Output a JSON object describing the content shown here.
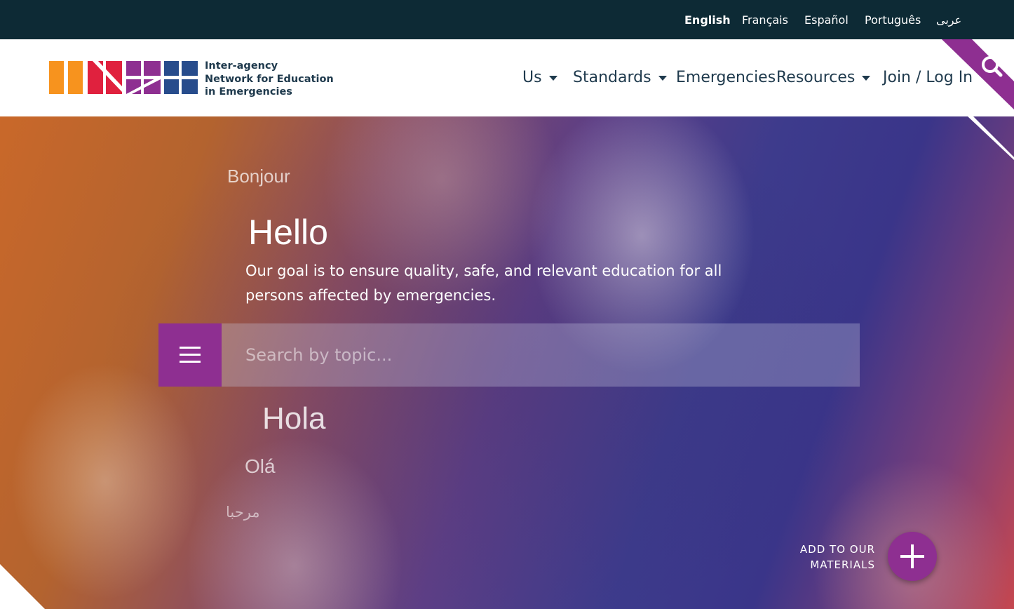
{
  "languages": {
    "english": "English",
    "francais": "Français",
    "espanol": "Español",
    "portugues": "Português",
    "arabic": "عربى"
  },
  "logo": {
    "line1": "Inter-agency",
    "line2": "Network for Education",
    "line3": "in Emergencies"
  },
  "nav": {
    "us": "Us",
    "standards": "Standards",
    "emergencies": "Emergencies",
    "resources": "Resources",
    "join": "Join / Log In"
  },
  "hero": {
    "bonjour": "Bonjour",
    "hello": "Hello",
    "description": "Our goal is to ensure quality, safe, and relevant education for all persons affected by emergencies.",
    "search_placeholder": "Search by topic...",
    "hola": "Hola",
    "ola": "Olá",
    "marhaba": "مرحبا"
  },
  "add_materials": {
    "line1": "ADD TO OUR",
    "line2": "MATERIALS"
  },
  "colors": {
    "top_bar": "#0d2a35",
    "brand_purple": "#8e2f91",
    "text_navy": "#1f3a4d",
    "logo_orange": "#f7931e",
    "logo_red": "#e0213e",
    "logo_purple": "#8e2f91",
    "logo_blue": "#274c8c"
  },
  "icons": {
    "search": "search-icon",
    "menu": "hamburger-menu-icon",
    "add": "plus-icon",
    "caret": "caret-down-icon"
  }
}
